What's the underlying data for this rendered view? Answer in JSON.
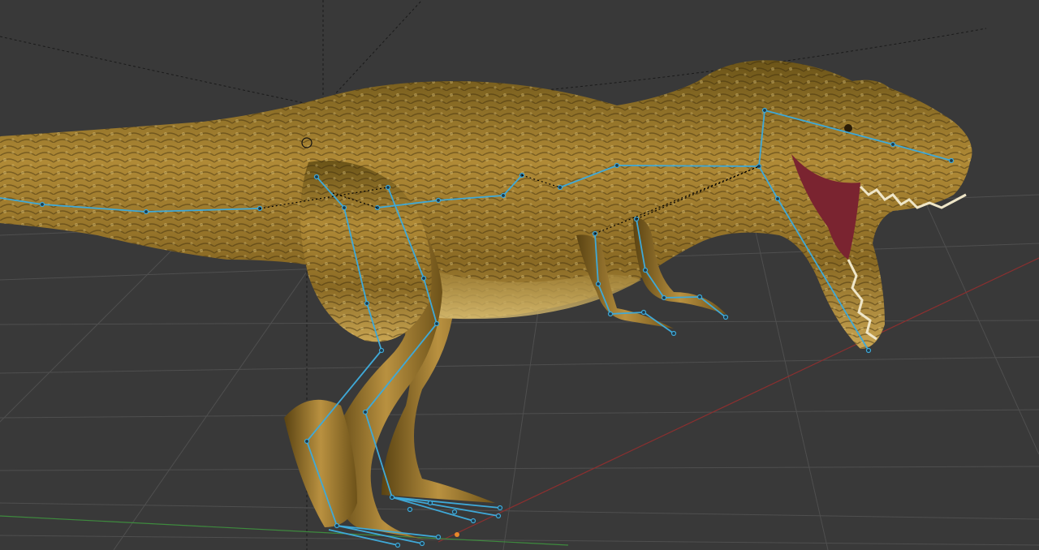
{
  "viewport": {
    "background": "#393939",
    "grid_color": "#4f4f4f",
    "x_axis_color": "#8c2f2f",
    "y_axis_color": "#3e8a3e"
  },
  "model": {
    "skin_base": "#8a6d28",
    "skin_light": "#d8b45a",
    "skin_dark": "#3a2a0c",
    "mouth_color": "#7a2430"
  },
  "armature": {
    "bone_color": "#3fa9d8",
    "parent_link_color": "#000000"
  },
  "markers": {
    "origin_color": "#e88a2a",
    "camera_line_color": "#1a1a1a"
  }
}
